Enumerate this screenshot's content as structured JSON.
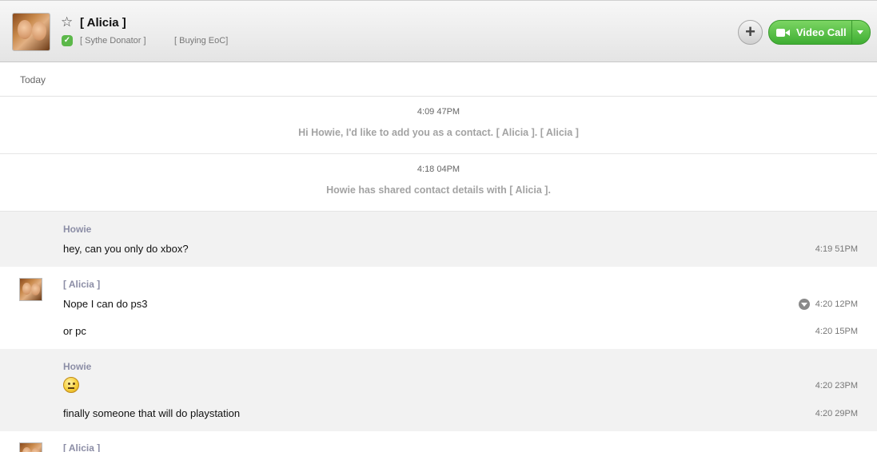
{
  "header": {
    "contact_name": "[ Alicia ]",
    "mood_1": "[ Sythe Donator ]",
    "mood_2": "[ Buying EoC]",
    "add_button": "+",
    "video_call_label": "Video Call",
    "accent_color": "#4cbf3c"
  },
  "conversation": {
    "date_label": "Today",
    "system_messages": [
      {
        "time": "4:09 47PM",
        "text": "Hi Howie, I'd like to add you as a contact. [ Alicia ]. [ Alicia ]"
      },
      {
        "time": "4:18 04PM",
        "text": "Howie has shared contact details with [ Alicia ]."
      }
    ],
    "groups": [
      {
        "sender": "Howie",
        "messages": [
          {
            "text": "hey, can you only do xbox?",
            "time": "4:19 51PM"
          }
        ]
      },
      {
        "sender": "[ Alicia ]",
        "messages": [
          {
            "text": "Nope I can do ps3",
            "time": "4:20 12PM"
          },
          {
            "text": "or pc",
            "time": "4:20 15PM"
          }
        ]
      },
      {
        "sender": "Howie",
        "messages": [
          {
            "text": "",
            "emoticon": "neutral-face",
            "time": "4:20 23PM"
          },
          {
            "text": "finally someone that will do playstation",
            "time": "4:20 29PM"
          }
        ]
      },
      {
        "sender": "[ Alicia ]",
        "messages": []
      }
    ]
  }
}
